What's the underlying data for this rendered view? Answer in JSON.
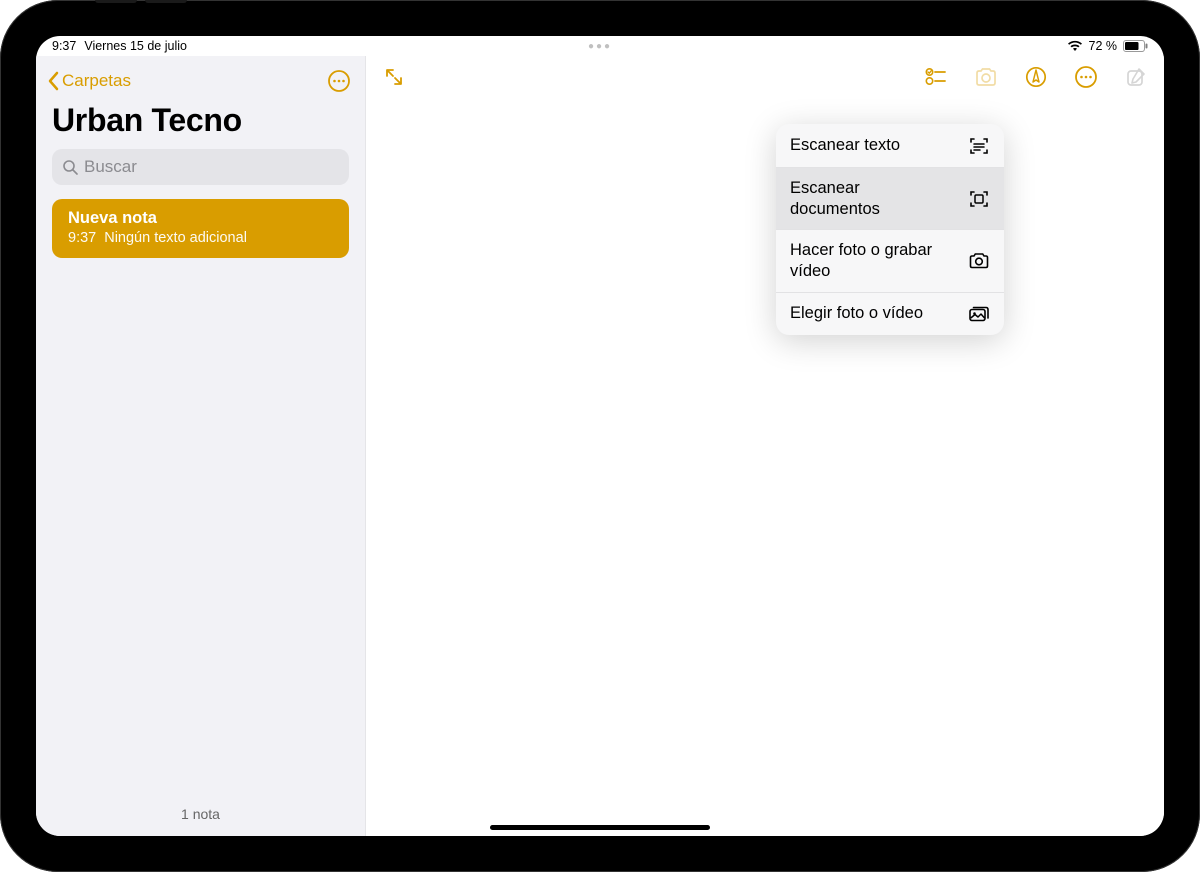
{
  "status": {
    "time": "9:37",
    "date": "Viernes 15 de julio",
    "battery_text": "72 %",
    "battery_level": 72
  },
  "colors": {
    "accent": "#d99d00"
  },
  "sidebar": {
    "back_label": "Carpetas",
    "title": "Urban Tecno",
    "search_placeholder": "Buscar",
    "footer": "1 nota",
    "notes": [
      {
        "title": "Nueva nota",
        "time": "9:37",
        "subtitle": "Ningún texto adicional",
        "selected": true
      }
    ]
  },
  "toolbar_icons": {
    "expand": "expand-icon",
    "checklist": "checklist-icon",
    "camera": "camera-icon",
    "markup": "markup-icon",
    "more": "more-icon",
    "compose": "compose-icon"
  },
  "camera_menu": {
    "items": [
      {
        "label": "Escanear texto",
        "icon": "scan-text-icon",
        "selected": false
      },
      {
        "label": "Escanear documentos",
        "icon": "scan-doc-icon",
        "selected": true
      },
      {
        "label": "Hacer foto o grabar vídeo",
        "icon": "camera-icon",
        "selected": false
      },
      {
        "label": "Elegir foto o vídeo",
        "icon": "photo-library-icon",
        "selected": false
      }
    ]
  }
}
